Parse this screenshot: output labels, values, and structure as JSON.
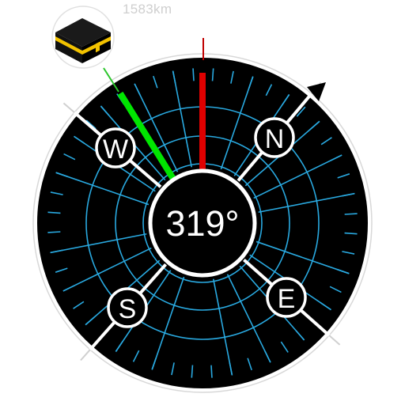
{
  "qibla": {
    "distance": "1583km",
    "heading": "319°",
    "heading_deg": 319,
    "kaaba_icon": "kaaba-icon"
  },
  "cardinals": [
    {
      "key": "north",
      "label": "N"
    },
    {
      "key": "east",
      "label": "E"
    },
    {
      "key": "south",
      "label": "S"
    },
    {
      "key": "west",
      "label": "W"
    }
  ],
  "colors": {
    "dial": "#000000",
    "grid": "#29a9e0",
    "rim": "#ffffff",
    "heading_needle": "#e00000",
    "qibla_needle": "#00e600",
    "kaaba_gold": "#f2c200"
  }
}
